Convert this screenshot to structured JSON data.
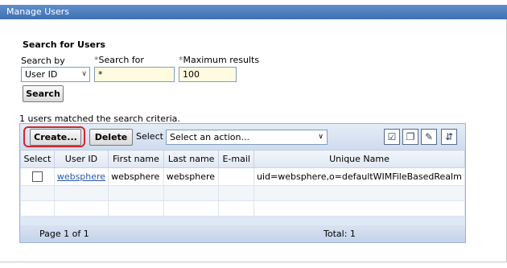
{
  "window": {
    "title": "Manage Users"
  },
  "search": {
    "section_title": "Search for Users",
    "search_by_label": "Search by",
    "search_by_value": "User ID",
    "search_for_label": "Search for",
    "search_for_value": "*",
    "max_results_label": "Maximum results",
    "max_results_value": "100",
    "required_marker": "*",
    "search_button": "Search"
  },
  "status": {
    "message": "1 users matched the search criteria."
  },
  "toolbar": {
    "create_button": "Create...",
    "delete_button": "Delete",
    "select_label": "Select",
    "action_placeholder": "Select an action...",
    "icons": [
      "select-all-icon",
      "deselect-all-icon",
      "show-filter-icon",
      "hide-filter-icon"
    ]
  },
  "table": {
    "columns": [
      "Select",
      "User ID",
      "First name",
      "Last name",
      "E-mail",
      "Unique Name"
    ],
    "rows": [
      {
        "user_id": "websphere",
        "first_name": "websphere",
        "last_name": "websphere",
        "email": "",
        "unique_name": "uid=websphere,o=defaultWIMFileBasedRealm"
      }
    ]
  },
  "pagination": {
    "page_text": "Page 1 of 1",
    "total_text": "Total: 1"
  },
  "colors": {
    "title_bar": "#3f6fb2",
    "highlight_box": "#d2262a",
    "link": "#2a56a8",
    "input_bg": "#fffbe0"
  }
}
